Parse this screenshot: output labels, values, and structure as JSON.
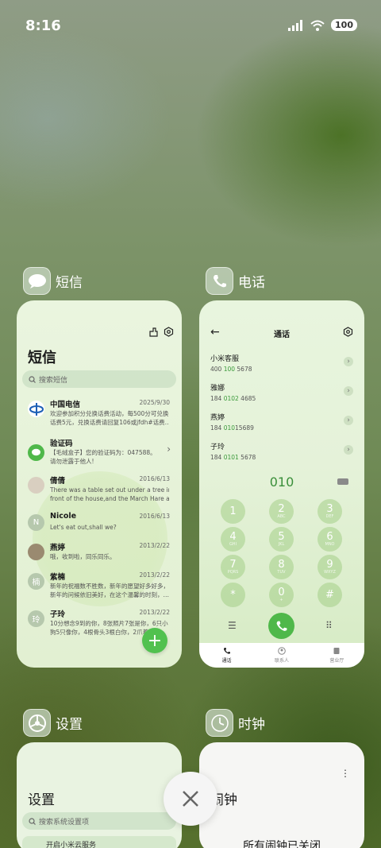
{
  "status_bar": {
    "time": "8:16",
    "battery": "100"
  },
  "apps": {
    "sms": {
      "label": "短信",
      "title": "短信",
      "search_placeholder": "搜索短信",
      "messages": [
        {
          "name": "中国电信",
          "date": "2025/9/30",
          "line1": "欢迎参加积分兑换话费活动，每500分可兑换",
          "line2": "话费5元，兑换话费请回复106或jfdh#话费…"
        },
        {
          "name": "验证码",
          "date": "",
          "line1": "【毛绒盒子】您的验证码为：047588。",
          "line2": "请勿泄露于他人!"
        },
        {
          "name": "倩倩",
          "date": "2016/6/13",
          "line1": "There was a table set out under a tree in",
          "line2": "front of the house,and the March Hare an…"
        },
        {
          "name": "Nicole",
          "date": "2016/6/13",
          "line1": "Let's eat out,shall we?",
          "line2": ""
        },
        {
          "name": "燕婷",
          "date": "2013/2/22",
          "line1": "哦，收到啦，同乐同乐。",
          "line2": ""
        },
        {
          "name": "紫楠",
          "date": "2013/2/22",
          "line1": "新年的祝福数不胜数，新年的愿望好多好多，",
          "line2": "新年的问候依旧美好，在这个温馨的时刻，…"
        },
        {
          "name": "子玲",
          "date": "2013/2/22",
          "line1": "10分想念9到的你，8张照片7张是你，6只小",
          "line2": "狗5只像你，4根骨头3根白你，2爪着她（"
        }
      ],
      "avatar_letters": {
        "nicole": "N",
        "zinan": "楠",
        "ziling": "玲"
      },
      "fab": "+"
    },
    "phone": {
      "label": "电话",
      "title": "通话",
      "contacts": [
        {
          "name": "小米客服",
          "num_a": "400 ",
          "num_hl": "100",
          "num_b": " 5678"
        },
        {
          "name": "雅娜",
          "num_a": "184 ",
          "num_hl": "0102",
          "num_b": " 4685"
        },
        {
          "name": "燕婷",
          "num_a": "184 ",
          "num_hl": "010",
          "num_b": "15689"
        },
        {
          "name": "子玲",
          "num_a": "184 ",
          "num_hl": "0101",
          "num_b": " 5678"
        }
      ],
      "dialed": "010",
      "keys": [
        {
          "d": "1",
          "l": ""
        },
        {
          "d": "2",
          "l": "ABC"
        },
        {
          "d": "3",
          "l": "DEF"
        },
        {
          "d": "4",
          "l": "GHI"
        },
        {
          "d": "5",
          "l": "JKL"
        },
        {
          "d": "6",
          "l": "MNO"
        },
        {
          "d": "7",
          "l": "PQRS"
        },
        {
          "d": "8",
          "l": "TUV"
        },
        {
          "d": "9",
          "l": "WXYZ"
        },
        {
          "d": "*",
          "l": ""
        },
        {
          "d": "0",
          "l": "+"
        },
        {
          "d": "#",
          "l": ""
        }
      ],
      "tabs": [
        "通话",
        "联系人",
        "营业厅"
      ]
    },
    "settings": {
      "label": "设置",
      "title": "设置",
      "search_placeholder": "搜索系统设置项",
      "row": "开启小米云服务"
    },
    "clock": {
      "label": "时钟",
      "title": "闹钟",
      "status": "所有闹钟已关闭"
    }
  },
  "colors": {
    "accent": "#4fb84a",
    "highlight": "#3a9a3a"
  }
}
